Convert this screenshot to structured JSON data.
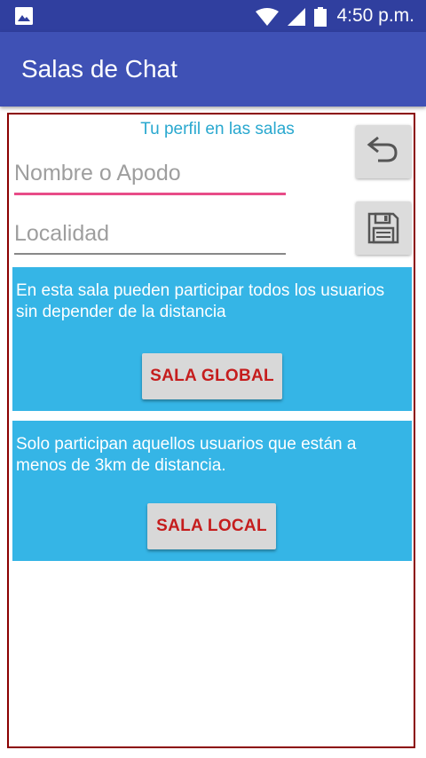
{
  "status_bar": {
    "time": "4:50 p.m.",
    "icons": [
      "gallery-icon",
      "wifi-icon",
      "signal-icon",
      "battery-icon"
    ]
  },
  "app_bar": {
    "title": "Salas de Chat"
  },
  "profile": {
    "section_title": "Tu perfil en las salas",
    "name_placeholder": "Nombre o Apodo",
    "name_value": "",
    "locality_placeholder": "Localidad",
    "locality_value": "",
    "undo_icon": "undo-icon",
    "save_icon": "floppy-disk-icon"
  },
  "rooms": {
    "global": {
      "description": "En esta sala pueden participar todos los usuarios sin depender de la distancia",
      "button_label": "SALA GLOBAL"
    },
    "local": {
      "description": "Solo participan aquellos usuarios que están a menos de 3km de distancia.",
      "button_label": "SALA LOCAL"
    }
  },
  "colors": {
    "status_bar": "#303F9F",
    "app_bar": "#3F51B5",
    "panel": "#35B5E6",
    "section_title": "#29A8CF",
    "button_text": "#C51D1D",
    "active_underline": "#E84C88",
    "content_border": "#8B0000"
  }
}
